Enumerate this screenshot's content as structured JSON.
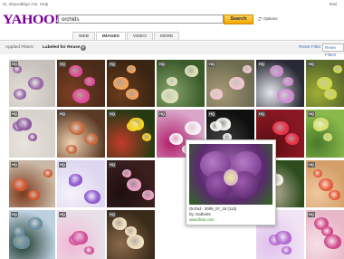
{
  "topbar": {
    "user": "Hi, shipouli",
    "signout": "Sign Out",
    "help": "Help",
    "mail": "Mail"
  },
  "logo": "YAHOO!",
  "search": {
    "query": "orchids",
    "button": "Search",
    "options": "Options"
  },
  "tabs": [
    "WEB",
    "IMAGES",
    "VIDEO",
    "MORE"
  ],
  "filters": {
    "applied_label": "Applied Filters:",
    "applied_value": "Labeled for Reuse",
    "reset": "Reset Filter",
    "reset_all": "Reset Filters"
  },
  "hq_badge": "HQ",
  "popup": {
    "title": "Orchid - 2009_07_18 (112)",
    "by": "By: Dalibo93",
    "source": "www.flickr.com"
  }
}
